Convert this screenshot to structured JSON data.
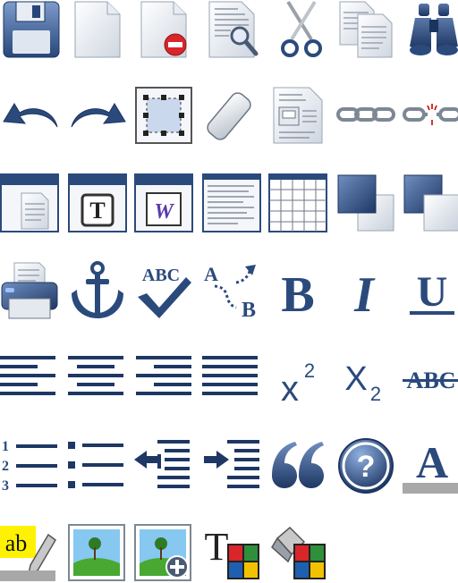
{
  "toolbar": {
    "spellcheck_text": "ABC",
    "replace_from": "A",
    "replace_to": "B",
    "bold": "B",
    "italic": "I",
    "underline": "U",
    "superscript_base": "x",
    "superscript_exp": "2",
    "subscript_base": "X",
    "subscript_exp": "2",
    "strikethrough": "ABC",
    "numbered": [
      "1",
      "2",
      "3"
    ],
    "help": "?",
    "font_color": "A",
    "highlight": "ab",
    "text_style": "T",
    "textbox": "T",
    "word_paste": "W"
  },
  "colors": {
    "primary": "#2b4a7c",
    "primary_light": "#6f8fbf",
    "paper": "#f4f6fa",
    "paper_edge": "#9aa5b5",
    "highlight": "#fff200",
    "grey_bar": "#a8a8a8",
    "red": "#d8262b",
    "palette": [
      "#d8262b",
      "#2f8f3a",
      "#1f5fb0",
      "#f2c200"
    ]
  }
}
